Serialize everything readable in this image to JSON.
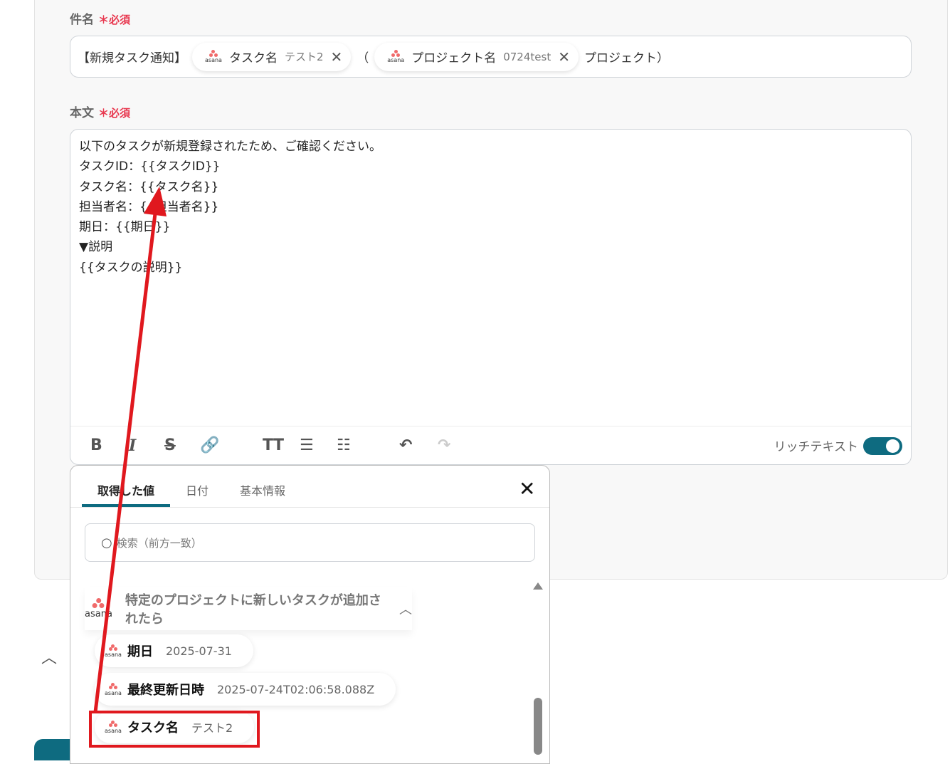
{
  "subject": {
    "label": "件名",
    "required": "＊必須",
    "prefix": "【新規タスク通知】",
    "pills": [
      {
        "app": "asana",
        "name": "タスク名",
        "value": "テスト2"
      },
      {
        "app": "asana",
        "name": "プロジェクト名",
        "value": "0724test"
      }
    ],
    "between": "（",
    "suffix": "プロジェクト）"
  },
  "body": {
    "label": "本文",
    "required": "＊必須",
    "text": "以下のタスクが新規登録されたため、ご確認ください。\nタスクID：{{タスクID}}\nタスク名：{{タスク名}}\n担当者名：{{担当者名}}\n期日：{{期日}}\n▼説明\n{{タスクの説明}}",
    "rich_text_label": "リッチテキスト",
    "rich_text_on": true
  },
  "popup": {
    "tabs": [
      "取得した値",
      "日付",
      "基本情報"
    ],
    "search_placeholder": "検索（前方一致）",
    "group_title": "特定のプロジェクトに新しいタスクが追加されたら",
    "app": "asana",
    "items": [
      {
        "name": "期日",
        "value": "2025-07-31"
      },
      {
        "name": "最終更新日時",
        "value": "2025-07-24T02:06:58.088Z"
      },
      {
        "name": "タスク名",
        "value": "テスト2"
      }
    ]
  },
  "colors": {
    "accent": "#0e6b80",
    "required": "#e8384f",
    "annotation": "#e0181e"
  }
}
